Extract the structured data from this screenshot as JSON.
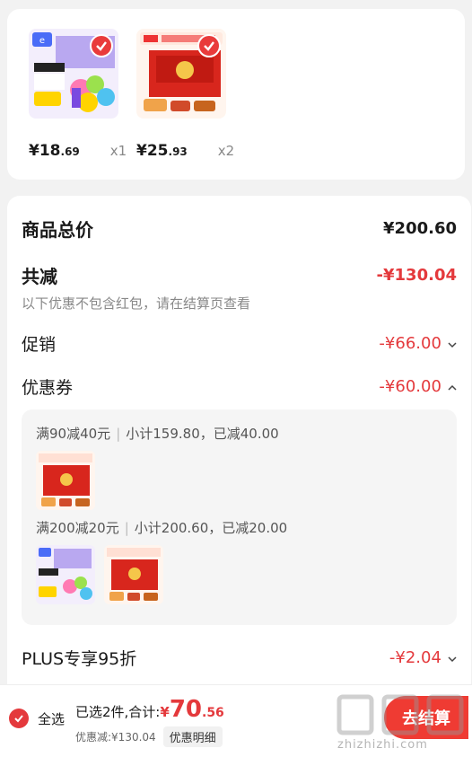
{
  "products": [
    {
      "price_yen": "¥",
      "price_int": "18",
      "price_dec": ".69",
      "qty": "x1",
      "thumb": "thumb-gift-box-1"
    },
    {
      "price_yen": "¥",
      "price_int": "25",
      "price_dec": ".93",
      "qty": "x2",
      "thumb": "thumb-gift-box-2"
    }
  ],
  "summary": {
    "total_label": "商品总价",
    "total_value": "¥200.60",
    "reduce_label": "共减",
    "reduce_value": "-¥130.04",
    "note": "以下优惠不包含红包，请在结算页查看",
    "promo_label": "促销",
    "promo_value": "-¥66.00",
    "coupon_label": "优惠券",
    "coupon_value": "-¥60.00",
    "plus_label": "PLUS专享95折",
    "plus_value": "-¥2.04"
  },
  "coupons": [
    {
      "rule": "满90减40元",
      "detail": "小计159.80，已减40.00"
    },
    {
      "rule": "满200减20元",
      "detail": "小计200.60，已减20.00"
    }
  ],
  "bottom": {
    "select_all": "全选",
    "selected_text": "已选2件,合计:",
    "amount_yen": "¥",
    "amount_int": "70",
    "amount_dec": ".56",
    "discount_text": "优惠减:¥130.04",
    "detail_btn": "优惠明细",
    "checkout": "去结算",
    "watermark": "zhizhizhi.com"
  },
  "colors": {
    "accent": "#e4393c",
    "checkout": "#ef3b33"
  }
}
